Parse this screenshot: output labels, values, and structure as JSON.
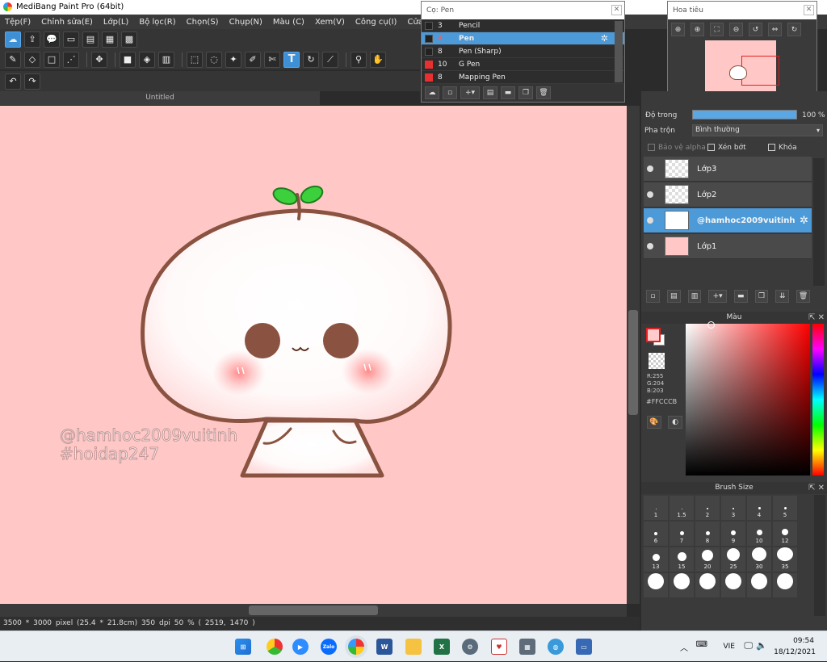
{
  "app": {
    "title": "MediBang Paint Pro (64bit)"
  },
  "menu": [
    "Tệp(F)",
    "Chỉnh sửa(E)",
    "Lớp(L)",
    "Bộ lọc(R)",
    "Chọn(S)",
    "Chụp(N)",
    "Màu (C)",
    "Xem(V)",
    "Công cụ(I)",
    "Cửa sổ(W)",
    "Cl"
  ],
  "document": {
    "tab_label": "Untitled"
  },
  "canvas": {
    "watermark_line1": "@hamhoc2009vuitinh",
    "watermark_line2": "#hoidap247",
    "bg_color": "#ffc8c6"
  },
  "status": {
    "text": "3500 * 3000 pixel   (25.4 * 21.8cm)   350 dpi   50 %   ( 2519, 1470 )"
  },
  "brush_window": {
    "title": "Cọ: Pen",
    "items": [
      {
        "size": "3",
        "name": "Pencil",
        "color": "#222222"
      },
      {
        "size": "4",
        "name": "Pen",
        "color": "#222222",
        "selected": true
      },
      {
        "size": "8",
        "name": "Pen (Sharp)",
        "color": "#222222"
      },
      {
        "size": "10",
        "name": "G Pen",
        "color": "#e83030"
      },
      {
        "size": "8",
        "name": "Mapping Pen",
        "color": "#e83030"
      }
    ]
  },
  "navigator": {
    "title": "Hoa tiêu"
  },
  "layers_panel": {
    "opacity_label": "Độ trong",
    "opacity_value": "100 %",
    "opacity_fraction": 1.0,
    "blend_label": "Pha trộn",
    "blend_value": "Bình thường",
    "protect_alpha": "Bảo vệ alpha",
    "clipping": "Xén bớt",
    "lock": "Khóa",
    "layers": [
      {
        "name": "Lớp3",
        "selected": false
      },
      {
        "name": "Lớp2",
        "selected": false
      },
      {
        "name": "@hamhoc2009vuitinh",
        "selected": true
      },
      {
        "name": "Lớp1",
        "selected": false
      }
    ]
  },
  "color_panel": {
    "title": "Màu",
    "r": "R:255",
    "g": "G:204",
    "b": "B:203",
    "hex": "#FFCCCB",
    "fg_color": "#FFCCCB"
  },
  "brush_size_panel": {
    "title": "Brush Size",
    "sizes": [
      "1",
      "1.5",
      "2",
      "3",
      "4",
      "5",
      "6",
      "7",
      "8",
      "9",
      "10",
      "12",
      "13",
      "15",
      "20",
      "25",
      "30",
      "35"
    ]
  },
  "taskbar": {
    "language": "VIE",
    "time": "09:54",
    "date": "18/12/2021"
  }
}
